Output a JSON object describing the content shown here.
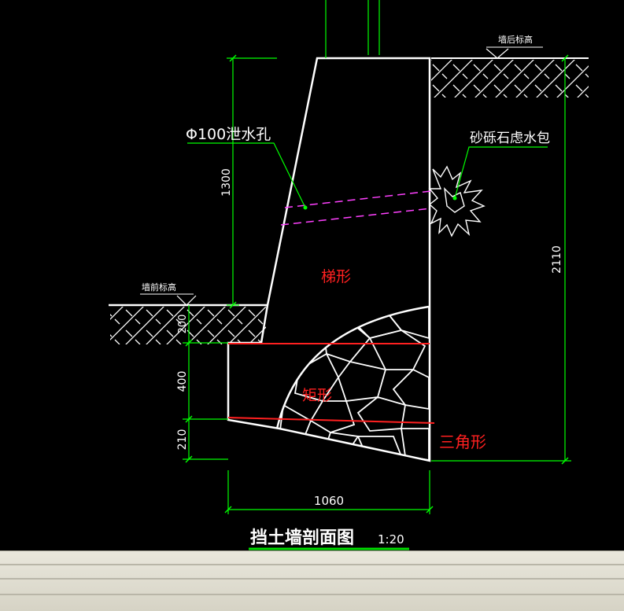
{
  "drawing": {
    "title": "挡土墙剖面图",
    "scale": "1:20",
    "labels": {
      "back_elevation": "墙后标高",
      "front_elevation": "墙前标高",
      "drain_hole": "Φ100泄水孔",
      "gravel_filter": "砂砾石虑水包",
      "trapezoid": "梯形",
      "rectangle": "矩形",
      "triangle": "三角形"
    },
    "dimensions": {
      "upper_height": "1300",
      "embed_depth": "200",
      "footing_height": "400",
      "toe_height": "210",
      "total_height": "2110",
      "base_width": "1060"
    }
  },
  "colors": {
    "background": "#000000",
    "wall_outline": "#ffffff",
    "dimension_lines": "#00ff00",
    "section_labels": "#ff2020",
    "drain_lines": "#ff40ff",
    "title_underline": "#00dd00"
  }
}
